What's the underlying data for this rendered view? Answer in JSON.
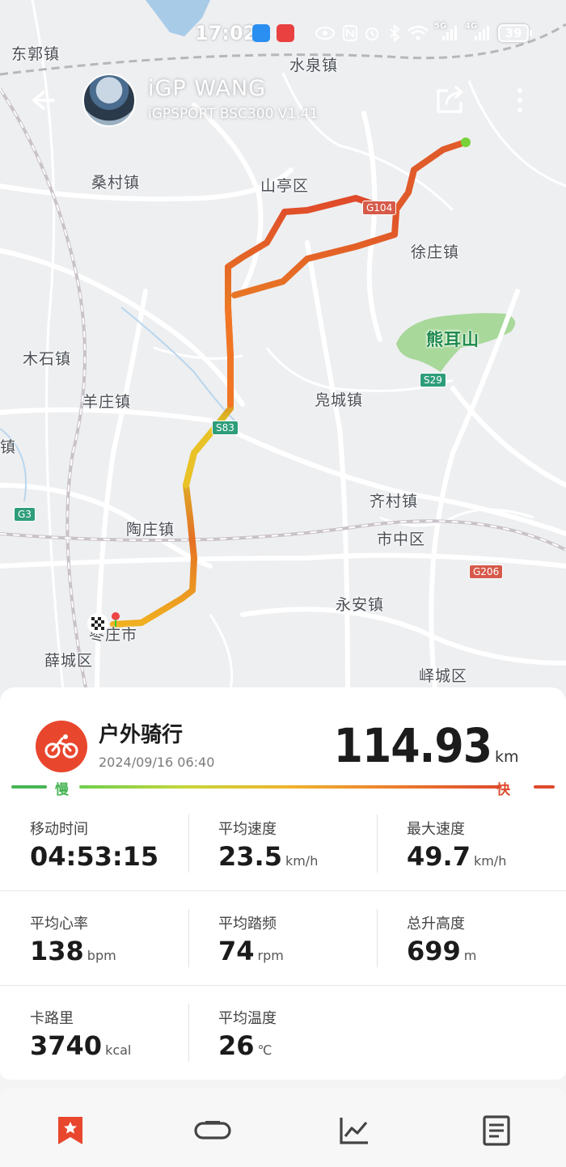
{
  "status_bar": {
    "time": "17:02",
    "battery": "39",
    "net1": "5G",
    "net2": "4G"
  },
  "header": {
    "user_name": "iGP  WANG",
    "device": "iGPSPORT BSC300  V1.41"
  },
  "map": {
    "places": [
      {
        "id": "dongguo",
        "name": "东郭镇"
      },
      {
        "id": "shuiquan",
        "name": "水泉镇"
      },
      {
        "id": "sangcun",
        "name": "桑村镇"
      },
      {
        "id": "shanting",
        "name": "山亭区"
      },
      {
        "id": "xuzhuang",
        "name": "徐庄镇"
      },
      {
        "id": "xiongershan",
        "name": "熊耳山"
      },
      {
        "id": "mushi",
        "name": "木石镇"
      },
      {
        "id": "yangzhuang",
        "name": "羊庄镇"
      },
      {
        "id": "fucheng",
        "name": "凫城镇"
      },
      {
        "id": "zhen-left",
        "name": "镇"
      },
      {
        "id": "qicun",
        "name": "齐村镇"
      },
      {
        "id": "taozhuang",
        "name": "陶庄镇"
      },
      {
        "id": "shizhong",
        "name": "市中区"
      },
      {
        "id": "yongan",
        "name": "永安镇"
      },
      {
        "id": "zaozhuang",
        "name": "枣庄市"
      },
      {
        "id": "xuecheng",
        "name": "薛城区"
      },
      {
        "id": "yicheng",
        "name": "峄城区"
      }
    ],
    "shields": [
      {
        "id": "g3",
        "text": "G3"
      },
      {
        "id": "s29",
        "text": "S29"
      },
      {
        "id": "s83",
        "text": "S83"
      },
      {
        "id": "g206",
        "text": "G206"
      },
      {
        "id": "top",
        "text": "G104"
      }
    ]
  },
  "activity": {
    "type": "户外骑行",
    "date": "2024/09/16 06:40",
    "distance": "114.93",
    "distance_unit": "km",
    "speed_slow": "慢",
    "speed_fast": "快"
  },
  "stats": [
    {
      "label": "移动时间",
      "value": "04:53:15",
      "unit": ""
    },
    {
      "label": "平均速度",
      "value": "23.5",
      "unit": "km/h"
    },
    {
      "label": "最大速度",
      "value": "49.7",
      "unit": "km/h"
    },
    {
      "label": "平均心率",
      "value": "138",
      "unit": "bpm"
    },
    {
      "label": "平均踏频",
      "value": "74",
      "unit": "rpm"
    },
    {
      "label": "总升高度",
      "value": "699",
      "unit": "m"
    },
    {
      "label": "卡路里",
      "value": "3740",
      "unit": "kcal"
    },
    {
      "label": "平均温度",
      "value": "26",
      "unit": "℃"
    }
  ],
  "colors": {
    "accent": "#e8472e",
    "slow": "#48b554",
    "fast": "#de4a2c"
  },
  "nav_icons": [
    "bookmark-icon",
    "device-icon",
    "chart-icon",
    "report-icon"
  ]
}
